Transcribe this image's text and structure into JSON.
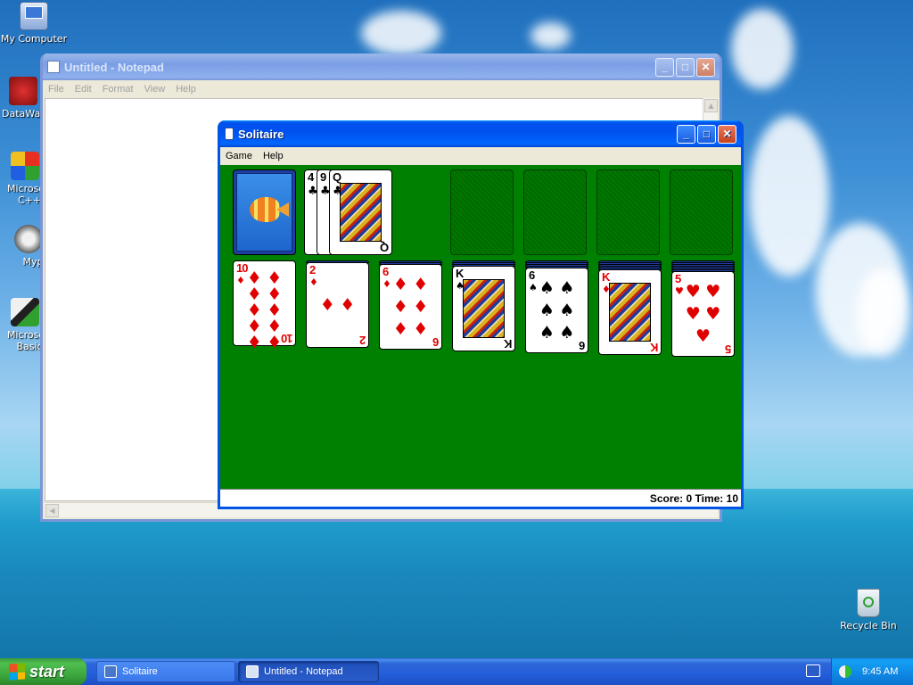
{
  "desktop": {
    "icons": [
      {
        "label": "My Computer",
        "icon": "my-computer-icon"
      },
      {
        "label": "DataWa",
        "icon": "datawa-icon"
      },
      {
        "label": "Microsoft C++",
        "icon": "microsoft-cpp-icon"
      },
      {
        "label": "Myp",
        "icon": "myp-icon"
      },
      {
        "label": "Microsoft Basic",
        "icon": "microsoft-basic-icon"
      },
      {
        "label": "Recycle Bin",
        "icon": "recycle-bin-icon"
      }
    ]
  },
  "notepad": {
    "title": "Untitled - Notepad",
    "menu": [
      "File",
      "Edit",
      "Format",
      "View",
      "Help"
    ]
  },
  "solitaire": {
    "title": "Solitaire",
    "menu": [
      "Game",
      "Help"
    ],
    "status": "Score: 0 Time: 10",
    "waste_ranks": [
      "4",
      "9",
      "Q"
    ],
    "tableau": [
      {
        "rank": "10",
        "suit": "♦",
        "color": "red"
      },
      {
        "rank": "2",
        "suit": "♦",
        "color": "red"
      },
      {
        "rank": "6",
        "suit": "♦",
        "color": "red"
      },
      {
        "rank": "K",
        "suit": "♠",
        "color": "black"
      },
      {
        "rank": "6",
        "suit": "♠",
        "color": "black"
      },
      {
        "rank": "K",
        "suit": "♦",
        "color": "red"
      },
      {
        "rank": "5",
        "suit": "♥",
        "color": "red"
      }
    ],
    "waste_top": {
      "rank": "Q",
      "suit": "♣",
      "color": "black"
    }
  },
  "taskbar": {
    "start_label": "start",
    "tasks": [
      {
        "label": "Solitaire",
        "state": "inactive"
      },
      {
        "label": "Untitled - Notepad",
        "state": "active"
      }
    ],
    "clock": "9:45 AM"
  },
  "colors": {
    "felt": "#008000",
    "title_active": "#0055e5",
    "red_suit": "#e00000"
  }
}
